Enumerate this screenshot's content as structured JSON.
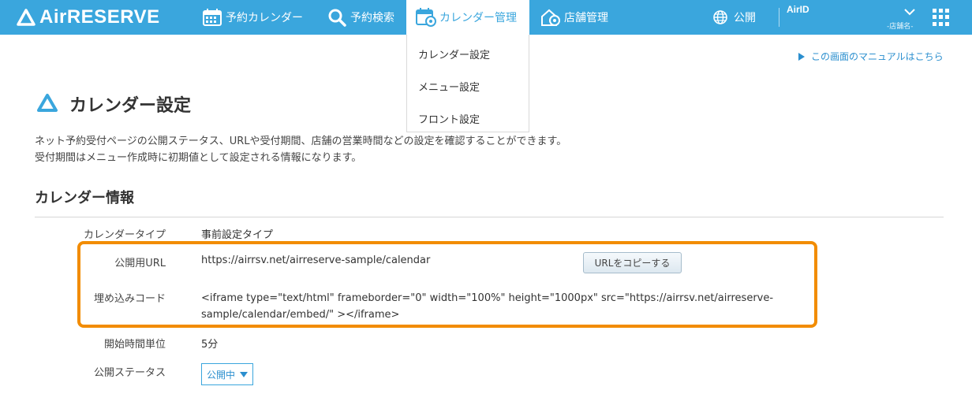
{
  "app": {
    "logo_text": "AirRESERVE"
  },
  "nav": {
    "calendar": "予約カレンダー",
    "search": "予約検索",
    "manage": "カレンダー管理",
    "store": "店舗管理",
    "public": "公開",
    "airid": "AirID",
    "store_name": "-店舗名-"
  },
  "dropdown": {
    "items": [
      "カレンダー設定",
      "メニュー設定",
      "フロント設定"
    ]
  },
  "manual_link": "この画面のマニュアルはこちら",
  "page_title": "カレンダー設定",
  "description": {
    "line1": "ネット予約受付ページの公開ステータス、URLや受付期間、店舗の営業時間などの設定を確認することができます。",
    "line2": "受付期間はメニュー作成時に初期値として設定される情報になります。"
  },
  "section": {
    "title": "カレンダー情報",
    "rows": {
      "type": {
        "label": "カレンダータイプ",
        "value": "事前設定タイプ"
      },
      "url": {
        "label": "公開用URL",
        "value": "https://airrsv.net/airreserve-sample/calendar",
        "button": "URLをコピーする"
      },
      "embed": {
        "label": "埋め込みコード",
        "value": "<iframe type=\"text/html\" frameborder=\"0\" width=\"100%\" height=\"1000px\" src=\"https://airrsv.net/airreserve-sample/calendar/embed/\" ></iframe>"
      },
      "unit": {
        "label": "開始時間単位",
        "value": "5分"
      },
      "status": {
        "label": "公開ステータス",
        "value": "公開中"
      }
    }
  },
  "colors": {
    "header": "#3aa6dd",
    "highlight": "#f28c00",
    "link": "#2b8fcf"
  },
  "icons": {
    "logo": "triangle-logo-icon",
    "calendar": "calendar-icon",
    "search": "search-icon",
    "manage": "calendar-gear-icon",
    "store": "store-gear-icon",
    "public": "globe-icon",
    "chevron": "chevron-down-icon",
    "apps": "apps-grid-icon"
  }
}
